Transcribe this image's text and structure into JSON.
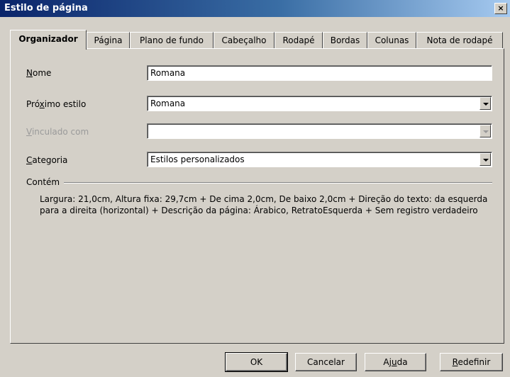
{
  "window": {
    "title": "Estilo de página",
    "close_glyph": "×"
  },
  "tabs": [
    {
      "label": "Organizador",
      "active": true
    },
    {
      "label": "Página"
    },
    {
      "label": "Plano de fundo"
    },
    {
      "label": "Cabeçalho"
    },
    {
      "label": "Rodapé"
    },
    {
      "label": "Bordas"
    },
    {
      "label": "Colunas"
    },
    {
      "label": "Nota de rodapé"
    }
  ],
  "form": {
    "name": {
      "label_pre": "",
      "label_key": "N",
      "label_post": "ome",
      "value": "Romana"
    },
    "next_style": {
      "label_pre": "Pró",
      "label_key": "x",
      "label_post": "imo estilo",
      "value": "Romana"
    },
    "linked_with": {
      "label_pre": "",
      "label_key": "V",
      "label_post": "inculado com",
      "value": ""
    },
    "category": {
      "label_pre": "",
      "label_key": "C",
      "label_post": "ategoria",
      "value": "Estilos personalizados"
    }
  },
  "contains": {
    "label": "Contém",
    "text": "Largura: 21,0cm, Altura fixa: 29,7cm + De cima 2,0cm, De baixo 2,0cm + Direção do texto: da esquerda para a direita (horizontal) + Descrição da página: Árabico, RetratoEsquerda + Sem registro verdadeiro"
  },
  "buttons": {
    "ok": "OK",
    "cancel": "Cancelar",
    "help_pre": "Aj",
    "help_key": "u",
    "help_post": "da",
    "reset_pre": "",
    "reset_key": "R",
    "reset_post": "edefinir"
  }
}
